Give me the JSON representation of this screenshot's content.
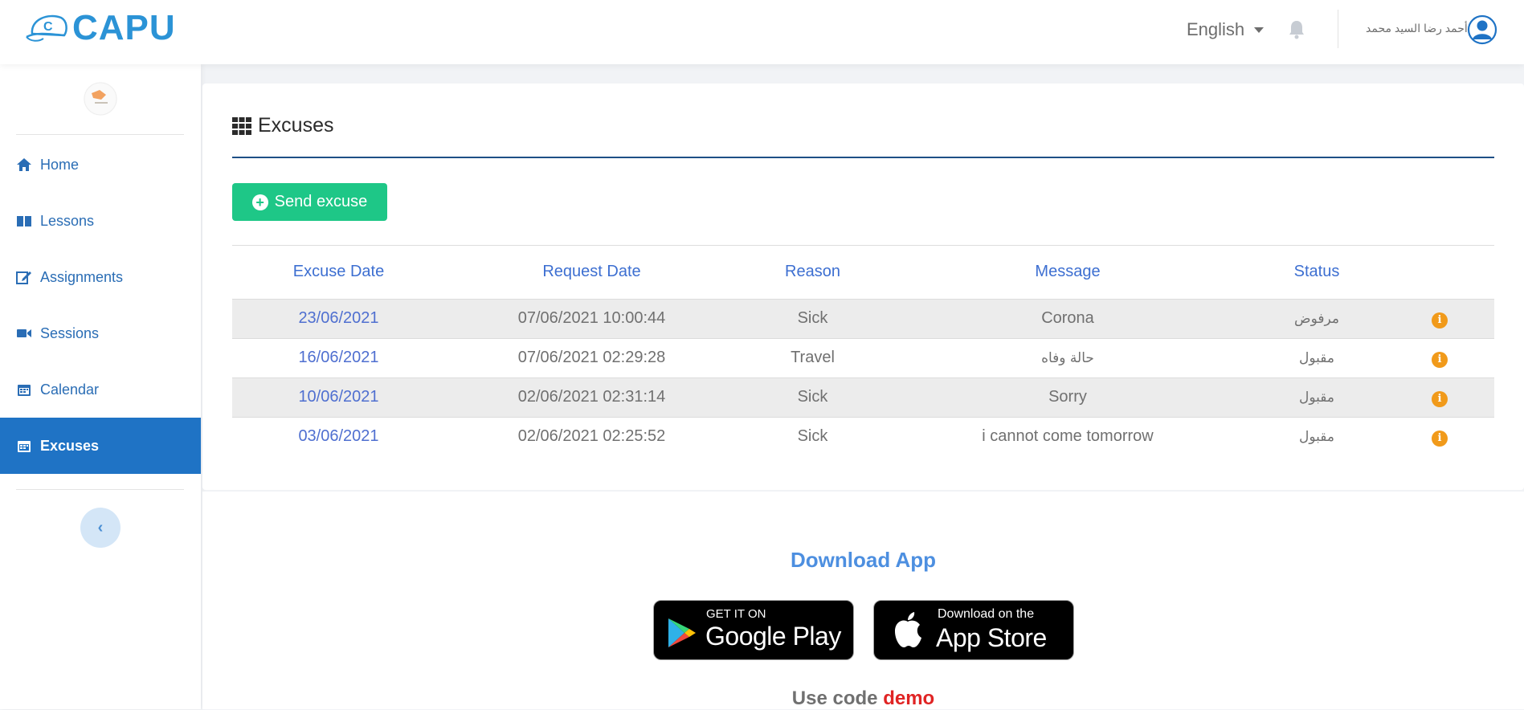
{
  "header": {
    "logo_text": "CAPU",
    "language": "English",
    "username": "أحمد رضا السيد محمد"
  },
  "sidebar": {
    "items": [
      {
        "label": "Home",
        "icon": "home-icon",
        "active": false
      },
      {
        "label": "Lessons",
        "icon": "book-icon",
        "active": false
      },
      {
        "label": "Assignments",
        "icon": "edit-icon",
        "active": false
      },
      {
        "label": "Sessions",
        "icon": "video-icon",
        "active": false
      },
      {
        "label": "Calendar",
        "icon": "calendar-icon",
        "active": false
      },
      {
        "label": "Excuses",
        "icon": "calendar-icon",
        "active": true
      }
    ],
    "collapse_label": "‹"
  },
  "main": {
    "title": "Excuses",
    "send_button": "Send excuse",
    "table": {
      "headers": [
        "Excuse Date",
        "Request Date",
        "Reason",
        "Message",
        "Status"
      ],
      "rows": [
        {
          "excuse_date": "23/06/2021",
          "request_date": "07/06/2021 10:00:44",
          "reason": "Sick",
          "message": "Corona",
          "status": "مرفوض"
        },
        {
          "excuse_date": "16/06/2021",
          "request_date": "07/06/2021 02:29:28",
          "reason": "Travel",
          "message": "حالة وفاه",
          "status": "مقبول"
        },
        {
          "excuse_date": "10/06/2021",
          "request_date": "02/06/2021 02:31:14",
          "reason": "Sick",
          "message": "Sorry",
          "status": "مقبول"
        },
        {
          "excuse_date": "03/06/2021",
          "request_date": "02/06/2021 02:25:52",
          "reason": "Sick",
          "message": "i cannot come tomorrow",
          "status": "مقبول"
        }
      ]
    }
  },
  "footer": {
    "download_title": "Download App",
    "google_play": {
      "small": "GET IT ON",
      "big": "Google Play"
    },
    "app_store": {
      "small": "Download on the",
      "big": "App Store"
    },
    "use_code_prefix": "Use code",
    "code": "demo"
  },
  "colors": {
    "accent": "#1f73c5",
    "success": "#1ec787",
    "link": "#3d6fd1",
    "code": "#e02424"
  }
}
